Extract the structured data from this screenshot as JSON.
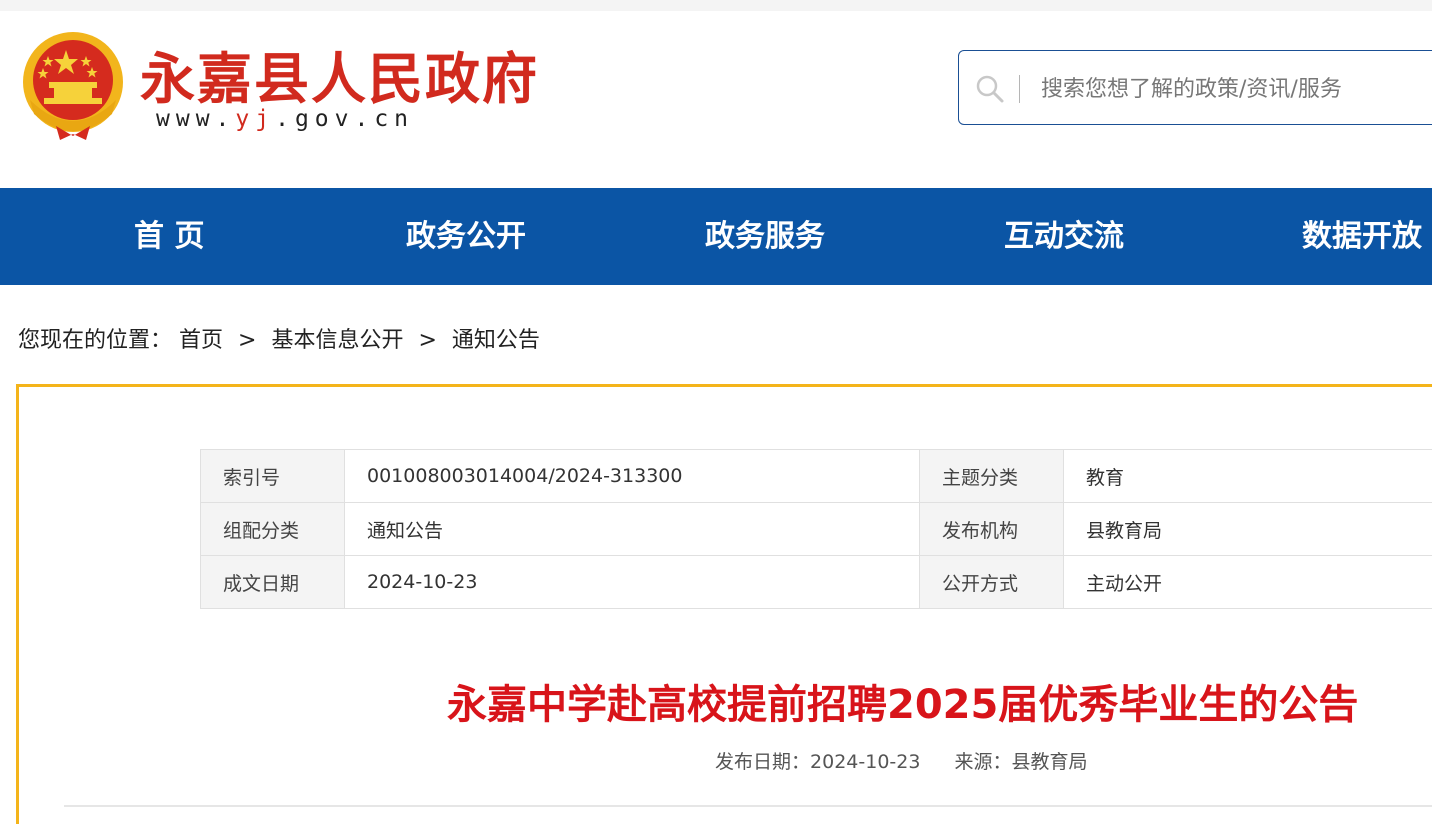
{
  "header": {
    "site_name": "永嘉县人民政府",
    "url_prefix": "www.",
    "url_highlight": "yj",
    "url_suffix": ".gov.cn",
    "emblem_icon": "national-emblem-icon"
  },
  "search": {
    "placeholder": "搜索您想了解的政策/资讯/服务",
    "icon": "search-icon"
  },
  "nav": {
    "items": [
      {
        "label": "首 页"
      },
      {
        "label": "政务公开"
      },
      {
        "label": "政务服务"
      },
      {
        "label": "互动交流"
      },
      {
        "label": "数据开放"
      }
    ]
  },
  "breadcrumb": {
    "prefix": "您现在的位置：",
    "items": [
      "首页",
      "基本信息公开",
      "通知公告"
    ],
    "separator": ">"
  },
  "info_table": {
    "rows": [
      {
        "label1": "索引号",
        "value1": "001008003014004/2024-313300",
        "label2": "主题分类",
        "value2": "教育"
      },
      {
        "label1": "组配分类",
        "value1": "通知公告",
        "label2": "发布机构",
        "value2": "县教育局"
      },
      {
        "label1": "成文日期",
        "value1": "2024-10-23",
        "label2": "公开方式",
        "value2": "主动公开"
      }
    ]
  },
  "article": {
    "title": "永嘉中学赴高校提前招聘2025届优秀毕业生的公告",
    "publish_label": "发布日期：",
    "publish_date": "2024-10-23",
    "source_label": "来源：",
    "source": "县教育局"
  },
  "colors": {
    "brand_red": "#d12a1e",
    "nav_blue": "#0b55a5",
    "frame_yellow": "#f4b41a",
    "title_red": "#d8141a"
  }
}
